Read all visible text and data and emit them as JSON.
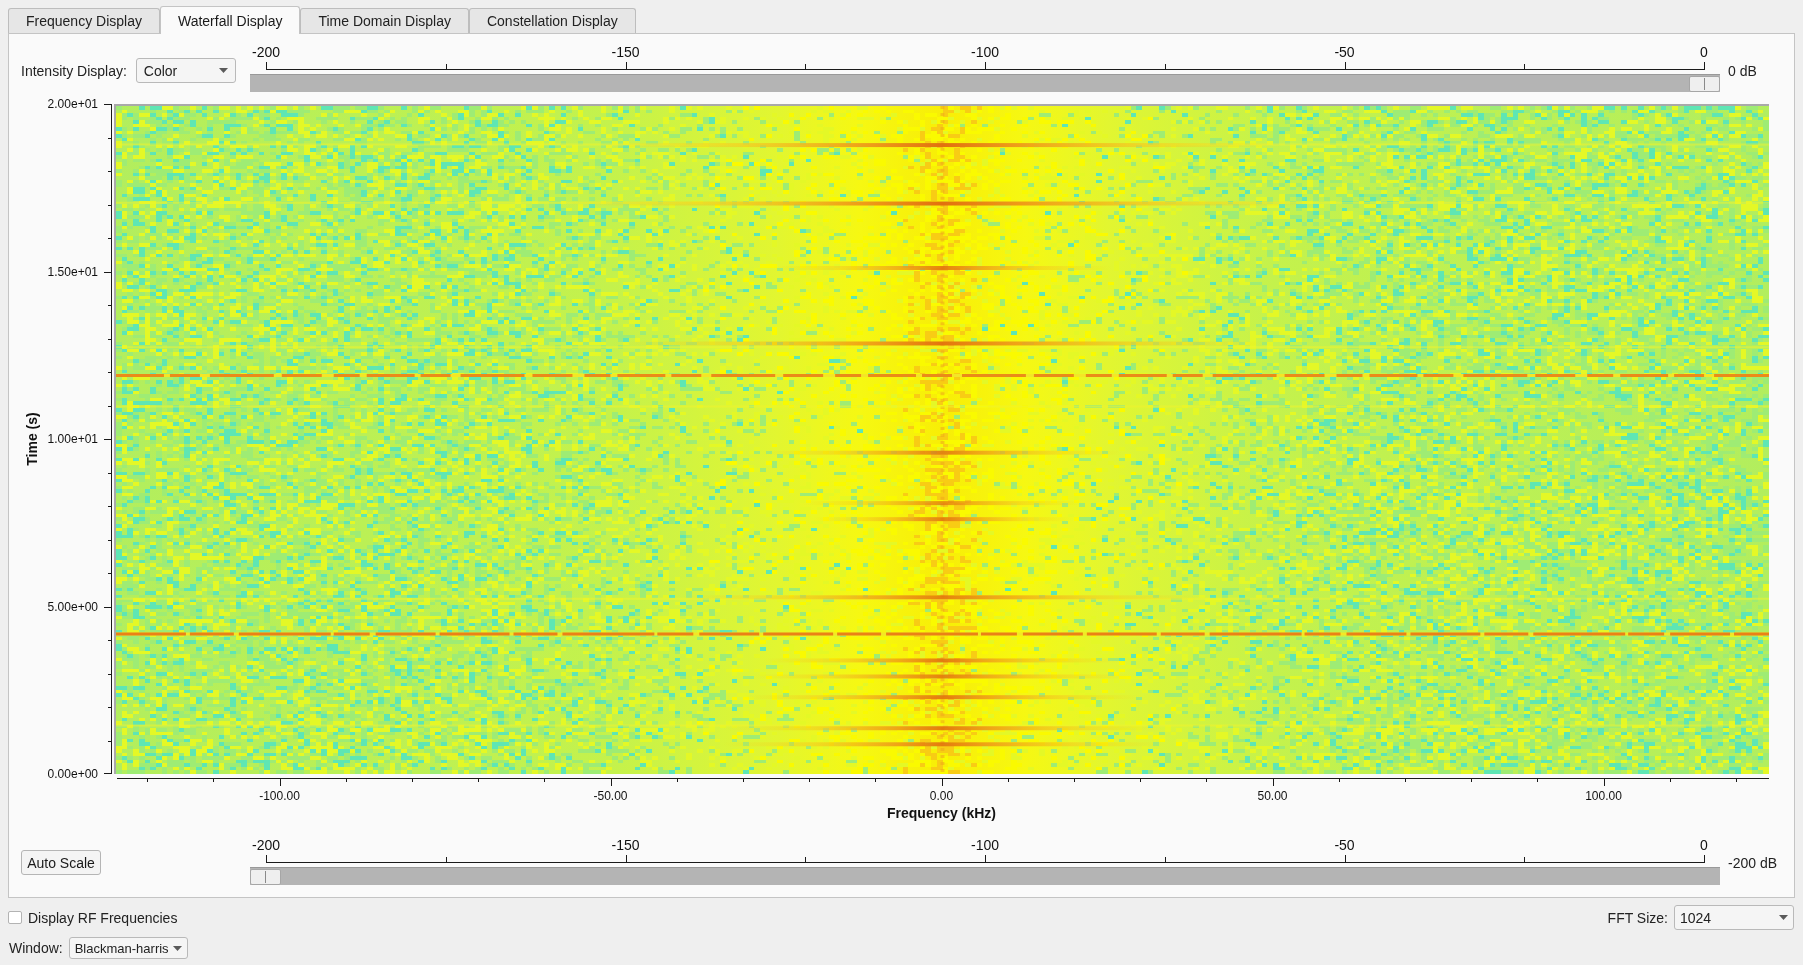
{
  "tabs": [
    {
      "label": "Frequency Display",
      "selected": false
    },
    {
      "label": "Waterfall Display",
      "selected": true
    },
    {
      "label": "Time Domain Display",
      "selected": false
    },
    {
      "label": "Constellation Display",
      "selected": false
    }
  ],
  "intensity_display": {
    "label": "Intensity Display:",
    "value": "Color"
  },
  "max_intensity_slider": {
    "scale_labels": [
      "-200",
      "-150",
      "-100",
      "-50",
      "0"
    ],
    "level": 1,
    "reading": "0 dB"
  },
  "waterfall_plot": {
    "ylabel": "Time (s)",
    "ytick_labels": [
      "2.00e+01",
      "1.50e+01",
      "1.00e+01",
      "5.00e+00",
      "0.00e+00"
    ],
    "xtick_labels": [
      "-100.00",
      "-50.00",
      "0.00",
      "50.00",
      "100.00"
    ],
    "xlabel": "Frequency (kHz)"
  },
  "auto_scale_button": {
    "label": "Auto Scale"
  },
  "min_intensity_slider": {
    "scale_labels": [
      "-200",
      "-150",
      "-100",
      "-50",
      "0"
    ],
    "level": 0,
    "reading": "-200 dB"
  },
  "display_rf_frequencies": {
    "label": "Display RF Frequencies",
    "checked": false
  },
  "fft_size": {
    "label": "FFT Size:",
    "value": "1024"
  },
  "window_function": {
    "label": "Window:",
    "value": "Blackman-harris"
  }
}
